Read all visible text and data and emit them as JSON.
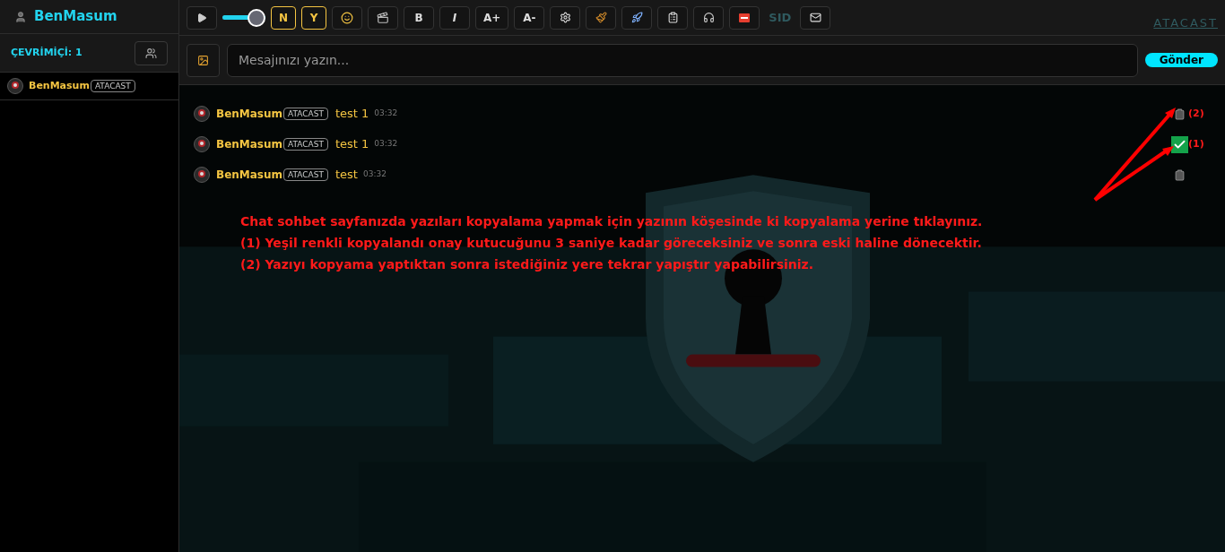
{
  "sidebar": {
    "username": "BenMasum",
    "online_label": "ÇEVRİMİÇİ: 1",
    "users": [
      {
        "name": "BenMasum",
        "badge": "ATACAST"
      }
    ]
  },
  "toolbar": {
    "volume": {
      "level": 1
    },
    "toggles": [
      {
        "label": "N",
        "on": true
      },
      {
        "label": "Y",
        "on": true
      }
    ],
    "format_buttons": [
      "B",
      "I",
      "A+",
      "A-"
    ],
    "sid_label": "SID",
    "brand": "ATACAST"
  },
  "composer": {
    "placeholder": "Mesajınızı yazın...",
    "send_label": "Gönder"
  },
  "messages": [
    {
      "author": "BenMasum",
      "badge": "ATACAST",
      "text": "test 1",
      "time": "03:32",
      "copied": false,
      "marker": "(2)"
    },
    {
      "author": "BenMasum",
      "badge": "ATACAST",
      "text": "test 1",
      "time": "03:32",
      "copied": true,
      "marker": "(1)"
    },
    {
      "author": "BenMasum",
      "badge": "ATACAST",
      "text": "test",
      "time": "03:32",
      "copied": false
    }
  ],
  "annotation": {
    "lines": [
      "Chat sohbet sayfanızda yazıları kopyalama yapmak için yazının köşesinde ki kopyalama yerine tıklayınız.",
      "(1) Yeşil renkli kopyalandı onay kutucuğunu 3 saniye kadar göreceksiniz ve sonra eski haline dönecektir.",
      "(2) Yazıyı kopyama yaptıktan sonra istediğiniz yere tekrar yapıştır yapabilirsiniz."
    ]
  }
}
